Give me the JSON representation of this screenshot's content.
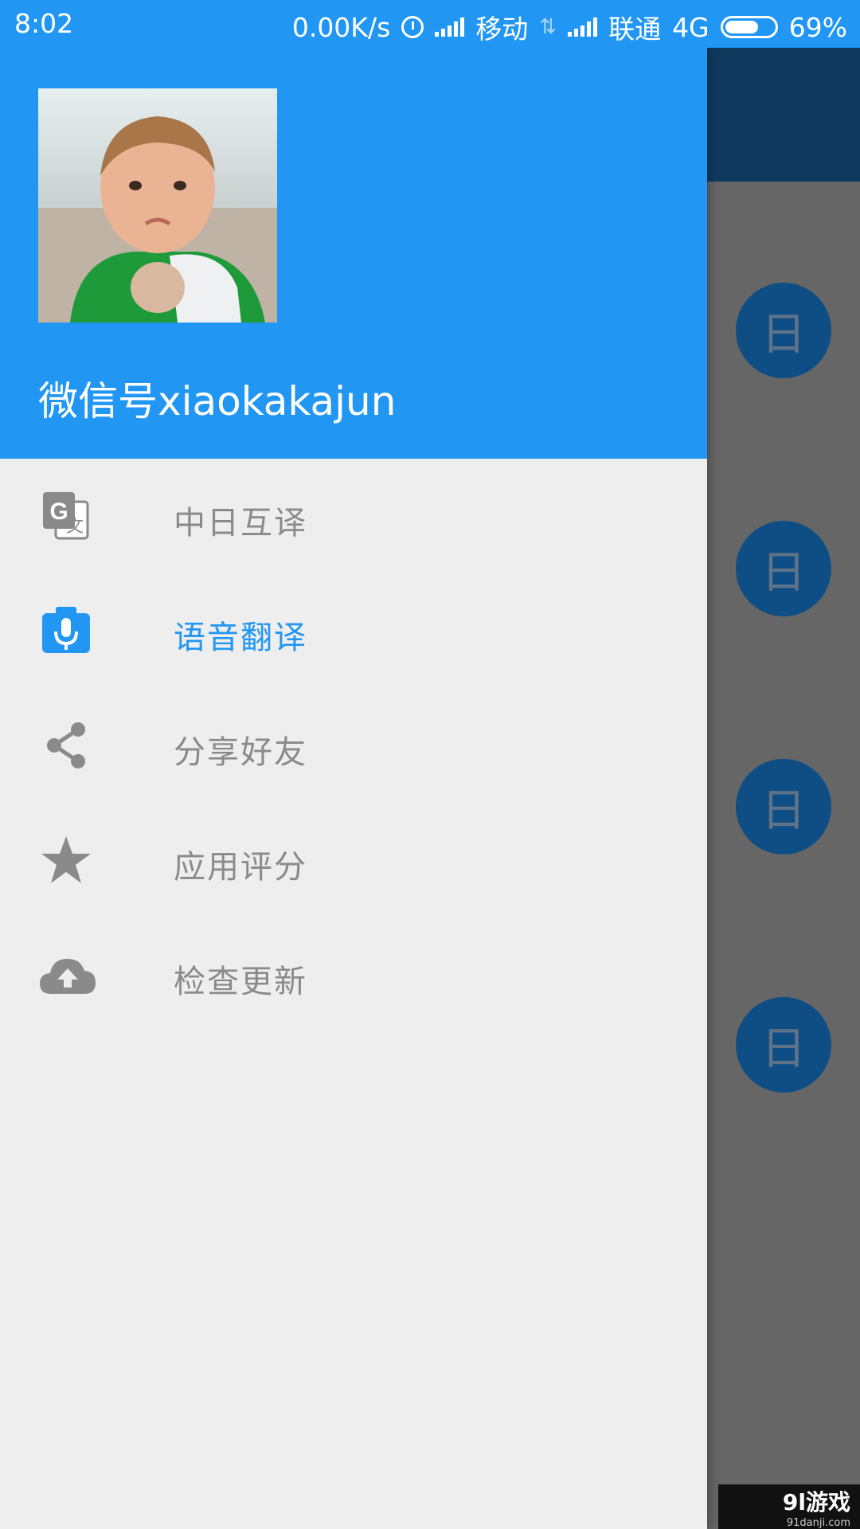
{
  "status_bar": {
    "time": "8:02",
    "speed": "0.00K/s",
    "carrier1": "移动",
    "carrier2": "联通",
    "network": "4G",
    "battery": "69%"
  },
  "drawer": {
    "username": "微信号xiaokakajun",
    "items": [
      {
        "label": "中日互译",
        "icon": "translate-icon",
        "active": false
      },
      {
        "label": "语音翻译",
        "icon": "voice-translate-icon",
        "active": true
      },
      {
        "label": "分享好友",
        "icon": "share-icon",
        "active": false
      },
      {
        "label": "应用评分",
        "icon": "star-icon",
        "active": false
      },
      {
        "label": "检查更新",
        "icon": "cloud-upload-icon",
        "active": false
      }
    ]
  },
  "background_app": {
    "fab_label": "日"
  },
  "watermark": {
    "brand": "9l游戏",
    "url": "91danji.com"
  },
  "colors": {
    "primary": "#2196F3",
    "drawer_bg": "#EEEEEF",
    "inactive_text": "#8A8A8A"
  }
}
